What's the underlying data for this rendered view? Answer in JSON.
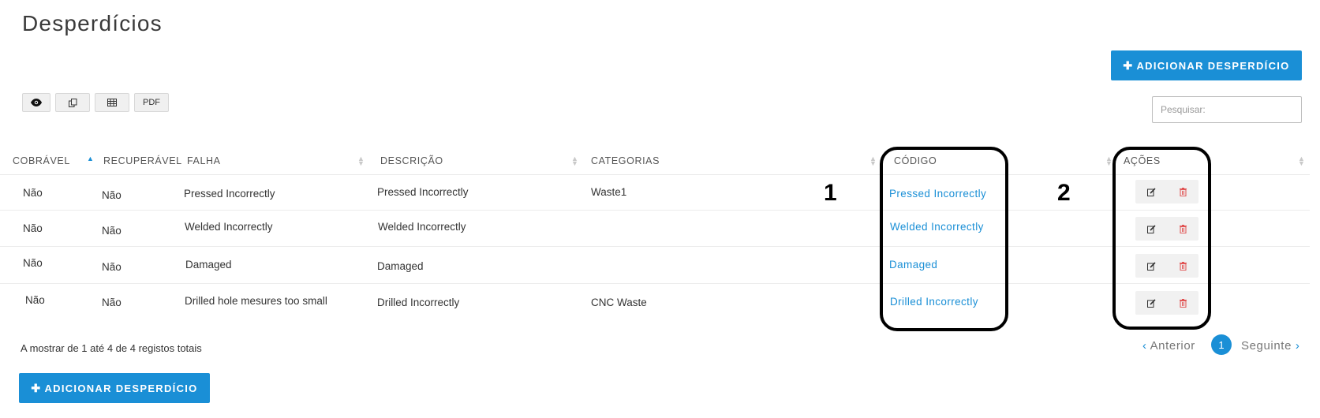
{
  "page": {
    "title": "Desperdícios"
  },
  "actions": {
    "add_label": "ADICIONAR DESPERDÍCIO"
  },
  "toolbar": {
    "view_icon": "eye-icon",
    "copy_icon": "copy-icon",
    "excel_icon": "table-icon",
    "pdf_label": "PDF"
  },
  "search": {
    "placeholder": "Pesquisar:",
    "value": ""
  },
  "table": {
    "columns": [
      {
        "key": "cobravel",
        "label": "COBRÁVEL"
      },
      {
        "key": "recuperavel",
        "label": "RECUPERÁVEL"
      },
      {
        "key": "falha",
        "label": "FALHA"
      },
      {
        "key": "descricao",
        "label": "DESCRIÇÃO"
      },
      {
        "key": "categorias",
        "label": "CATEGORIAS"
      },
      {
        "key": "codigo",
        "label": "CÓDIGO"
      },
      {
        "key": "acoes",
        "label": "AÇÕES"
      }
    ],
    "sorted_column": "cobravel",
    "rows": [
      {
        "cobravel": "Não",
        "recuperavel": "Não",
        "falha": "Pressed Incorrectly",
        "descricao": "Pressed Incorrectly",
        "categorias": "Waste1",
        "codigo": "Pressed Incorrectly"
      },
      {
        "cobravel": "Não",
        "recuperavel": "Não",
        "falha": "Welded Incorrectly",
        "descricao": "Welded Incorrectly",
        "categorias": "",
        "codigo": "Welded Incorrectly"
      },
      {
        "cobravel": "Não",
        "recuperavel": "Não",
        "falha": "Damaged",
        "descricao": "Damaged",
        "categorias": "",
        "codigo": "Damaged"
      },
      {
        "cobravel": "Não",
        "recuperavel": "Não",
        "falha": "Drilled hole mesures too small",
        "descricao": "Drilled Incorrectly",
        "categorias": "CNC Waste",
        "codigo": "Drilled Incorrectly"
      }
    ]
  },
  "annotations": {
    "callout_1": "1",
    "callout_2": "2"
  },
  "footer": {
    "info": "A mostrar de 1 até 4 de 4 registos totais"
  },
  "pagination": {
    "prev_label": "Anterior",
    "current_page": "1",
    "next_label": "Seguinte"
  },
  "colors": {
    "accent": "#1a8fd6",
    "delete": "#e05050",
    "callout": "#000000"
  }
}
